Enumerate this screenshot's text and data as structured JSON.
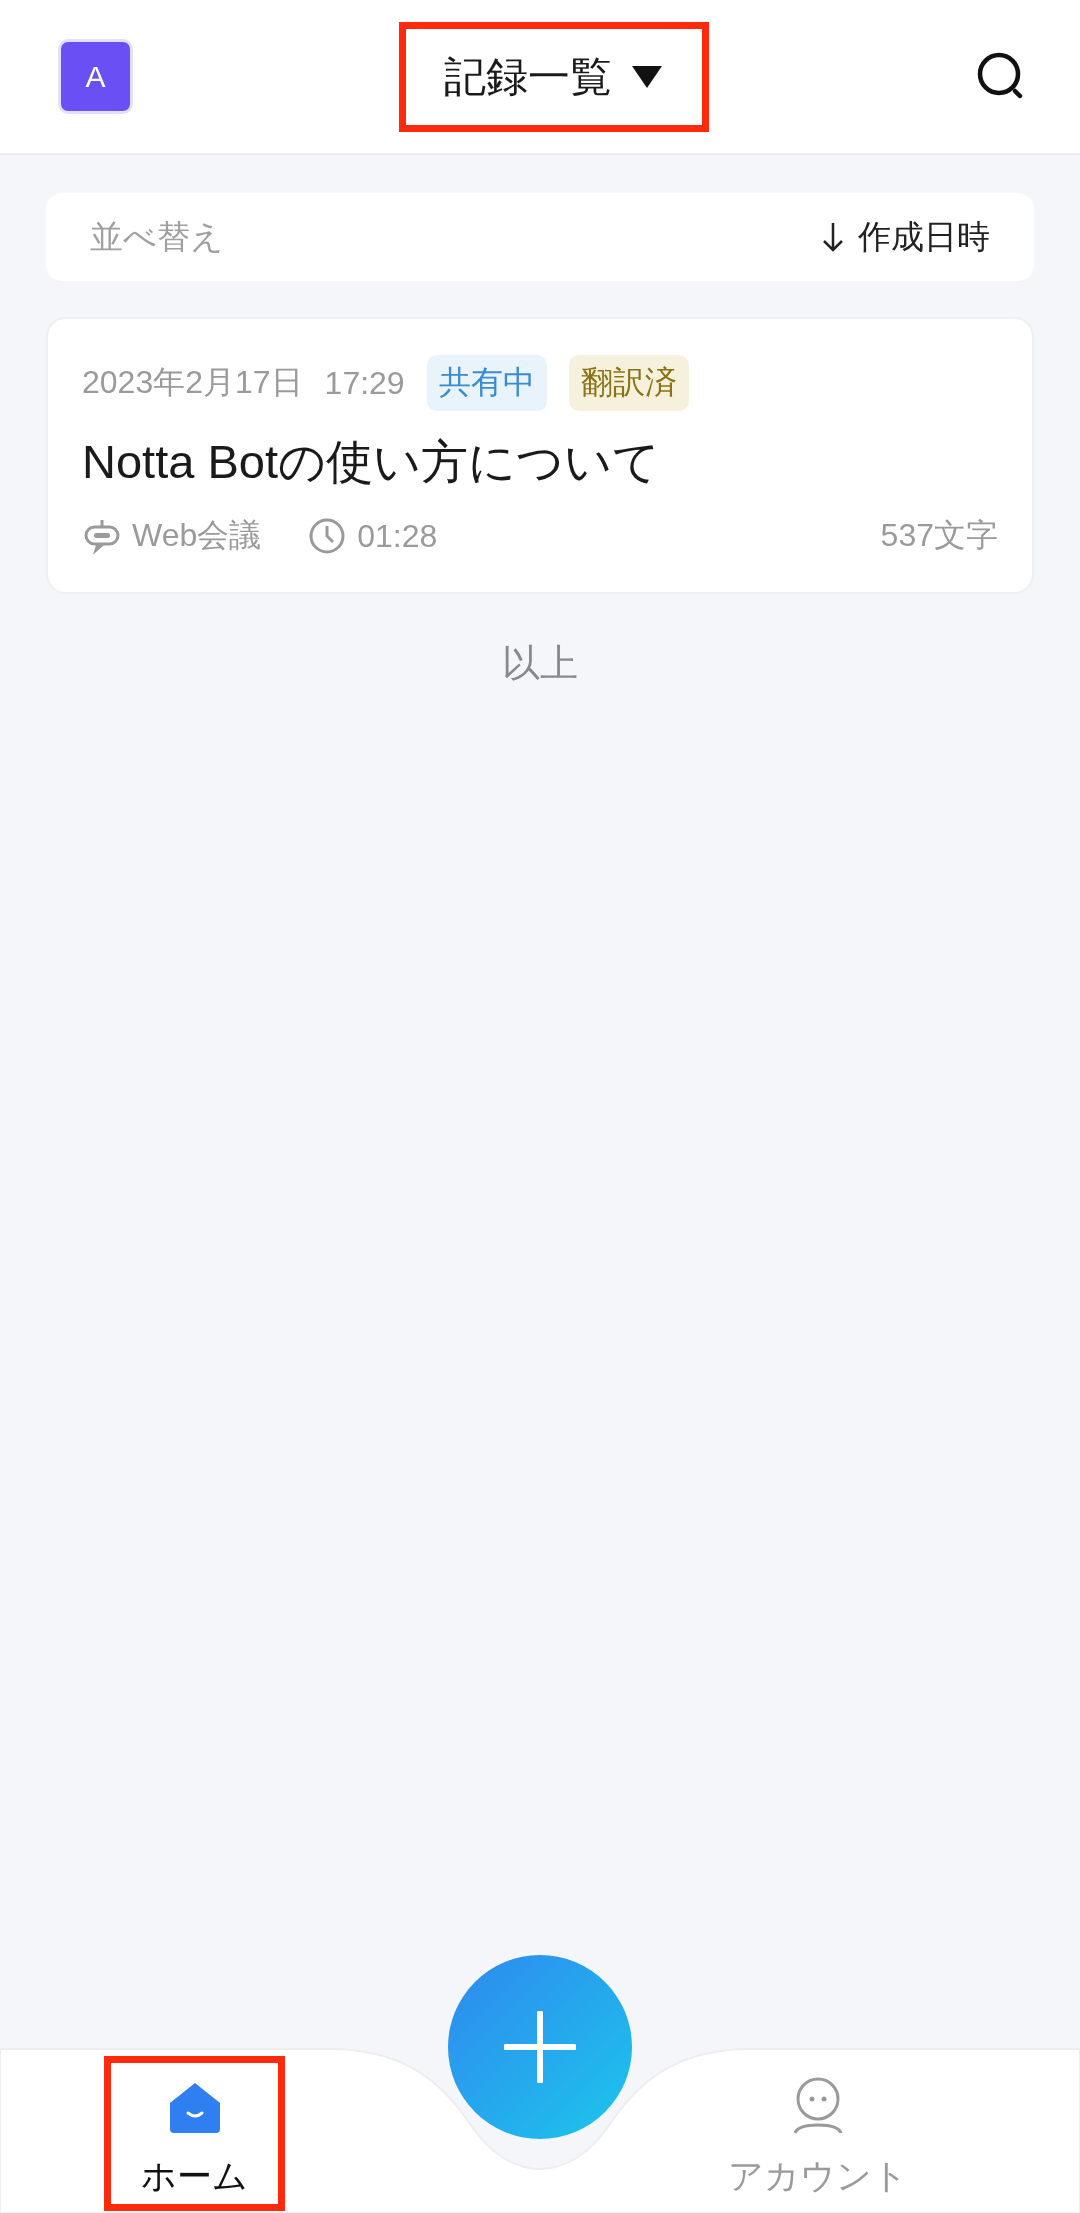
{
  "header": {
    "avatar": "A",
    "title": "記録一覧",
    "highlighted": true
  },
  "sort": {
    "label": "並べ替え",
    "value": "作成日時"
  },
  "records": [
    {
      "date": "2023年2月17日",
      "time": "17:29",
      "tags": [
        {
          "label": "共有中",
          "kind": "shared"
        },
        {
          "label": "翻訳済",
          "kind": "translated"
        }
      ],
      "title": "Notta Botの使い方について",
      "source": "Web会議",
      "duration": "01:28",
      "length": "537文字"
    }
  ],
  "end_label": "以上",
  "nav": [
    {
      "label": "ホーム",
      "kind": "home",
      "selected": true,
      "highlighted": true
    },
    {
      "label": "アカウント",
      "kind": "account",
      "selected": false,
      "highlighted": false
    }
  ]
}
